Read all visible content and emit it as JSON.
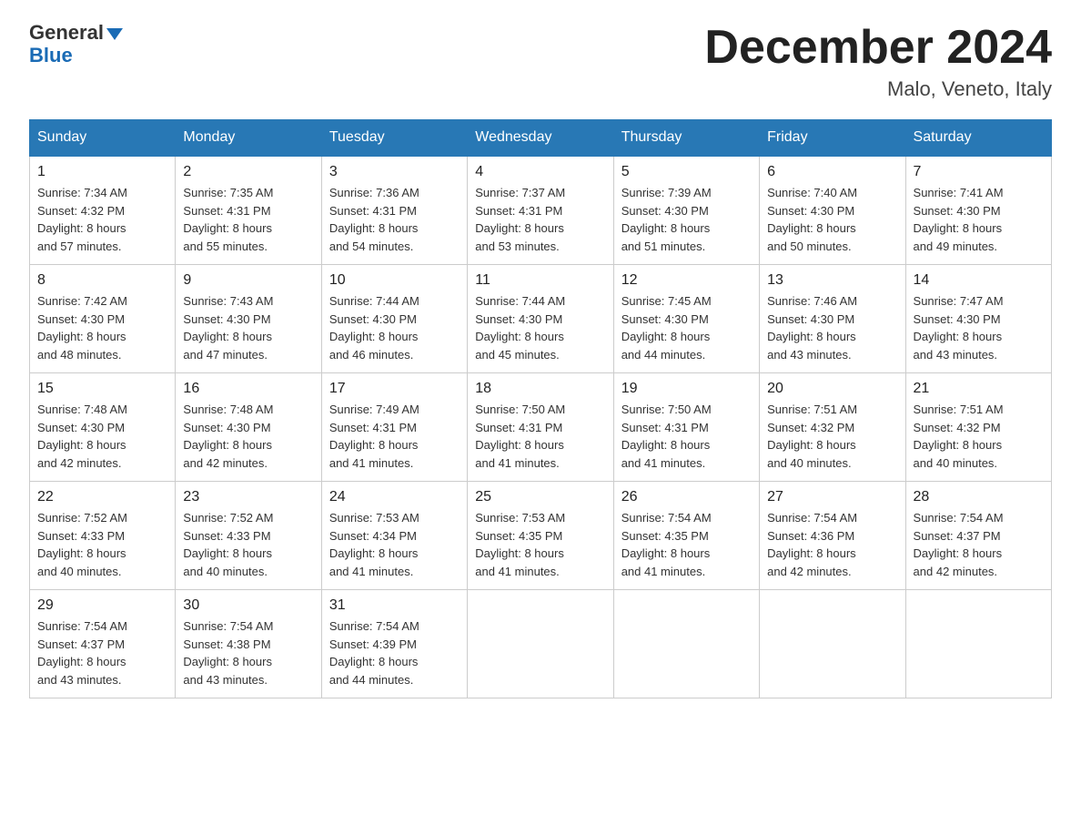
{
  "logo": {
    "line1": "General",
    "line2": "Blue"
  },
  "title": "December 2024",
  "subtitle": "Malo, Veneto, Italy",
  "days_of_week": [
    "Sunday",
    "Monday",
    "Tuesday",
    "Wednesday",
    "Thursday",
    "Friday",
    "Saturday"
  ],
  "weeks": [
    [
      {
        "day": "1",
        "sunrise": "7:34 AM",
        "sunset": "4:32 PM",
        "daylight": "8 hours and 57 minutes."
      },
      {
        "day": "2",
        "sunrise": "7:35 AM",
        "sunset": "4:31 PM",
        "daylight": "8 hours and 55 minutes."
      },
      {
        "day": "3",
        "sunrise": "7:36 AM",
        "sunset": "4:31 PM",
        "daylight": "8 hours and 54 minutes."
      },
      {
        "day": "4",
        "sunrise": "7:37 AM",
        "sunset": "4:31 PM",
        "daylight": "8 hours and 53 minutes."
      },
      {
        "day": "5",
        "sunrise": "7:39 AM",
        "sunset": "4:30 PM",
        "daylight": "8 hours and 51 minutes."
      },
      {
        "day": "6",
        "sunrise": "7:40 AM",
        "sunset": "4:30 PM",
        "daylight": "8 hours and 50 minutes."
      },
      {
        "day": "7",
        "sunrise": "7:41 AM",
        "sunset": "4:30 PM",
        "daylight": "8 hours and 49 minutes."
      }
    ],
    [
      {
        "day": "8",
        "sunrise": "7:42 AM",
        "sunset": "4:30 PM",
        "daylight": "8 hours and 48 minutes."
      },
      {
        "day": "9",
        "sunrise": "7:43 AM",
        "sunset": "4:30 PM",
        "daylight": "8 hours and 47 minutes."
      },
      {
        "day": "10",
        "sunrise": "7:44 AM",
        "sunset": "4:30 PM",
        "daylight": "8 hours and 46 minutes."
      },
      {
        "day": "11",
        "sunrise": "7:44 AM",
        "sunset": "4:30 PM",
        "daylight": "8 hours and 45 minutes."
      },
      {
        "day": "12",
        "sunrise": "7:45 AM",
        "sunset": "4:30 PM",
        "daylight": "8 hours and 44 minutes."
      },
      {
        "day": "13",
        "sunrise": "7:46 AM",
        "sunset": "4:30 PM",
        "daylight": "8 hours and 43 minutes."
      },
      {
        "day": "14",
        "sunrise": "7:47 AM",
        "sunset": "4:30 PM",
        "daylight": "8 hours and 43 minutes."
      }
    ],
    [
      {
        "day": "15",
        "sunrise": "7:48 AM",
        "sunset": "4:30 PM",
        "daylight": "8 hours and 42 minutes."
      },
      {
        "day": "16",
        "sunrise": "7:48 AM",
        "sunset": "4:30 PM",
        "daylight": "8 hours and 42 minutes."
      },
      {
        "day": "17",
        "sunrise": "7:49 AM",
        "sunset": "4:31 PM",
        "daylight": "8 hours and 41 minutes."
      },
      {
        "day": "18",
        "sunrise": "7:50 AM",
        "sunset": "4:31 PM",
        "daylight": "8 hours and 41 minutes."
      },
      {
        "day": "19",
        "sunrise": "7:50 AM",
        "sunset": "4:31 PM",
        "daylight": "8 hours and 41 minutes."
      },
      {
        "day": "20",
        "sunrise": "7:51 AM",
        "sunset": "4:32 PM",
        "daylight": "8 hours and 40 minutes."
      },
      {
        "day": "21",
        "sunrise": "7:51 AM",
        "sunset": "4:32 PM",
        "daylight": "8 hours and 40 minutes."
      }
    ],
    [
      {
        "day": "22",
        "sunrise": "7:52 AM",
        "sunset": "4:33 PM",
        "daylight": "8 hours and 40 minutes."
      },
      {
        "day": "23",
        "sunrise": "7:52 AM",
        "sunset": "4:33 PM",
        "daylight": "8 hours and 40 minutes."
      },
      {
        "day": "24",
        "sunrise": "7:53 AM",
        "sunset": "4:34 PM",
        "daylight": "8 hours and 41 minutes."
      },
      {
        "day": "25",
        "sunrise": "7:53 AM",
        "sunset": "4:35 PM",
        "daylight": "8 hours and 41 minutes."
      },
      {
        "day": "26",
        "sunrise": "7:54 AM",
        "sunset": "4:35 PM",
        "daylight": "8 hours and 41 minutes."
      },
      {
        "day": "27",
        "sunrise": "7:54 AM",
        "sunset": "4:36 PM",
        "daylight": "8 hours and 42 minutes."
      },
      {
        "day": "28",
        "sunrise": "7:54 AM",
        "sunset": "4:37 PM",
        "daylight": "8 hours and 42 minutes."
      }
    ],
    [
      {
        "day": "29",
        "sunrise": "7:54 AM",
        "sunset": "4:37 PM",
        "daylight": "8 hours and 43 minutes."
      },
      {
        "day": "30",
        "sunrise": "7:54 AM",
        "sunset": "4:38 PM",
        "daylight": "8 hours and 43 minutes."
      },
      {
        "day": "31",
        "sunrise": "7:54 AM",
        "sunset": "4:39 PM",
        "daylight": "8 hours and 44 minutes."
      },
      null,
      null,
      null,
      null
    ]
  ],
  "labels": {
    "sunrise": "Sunrise:",
    "sunset": "Sunset:",
    "daylight": "Daylight:"
  }
}
